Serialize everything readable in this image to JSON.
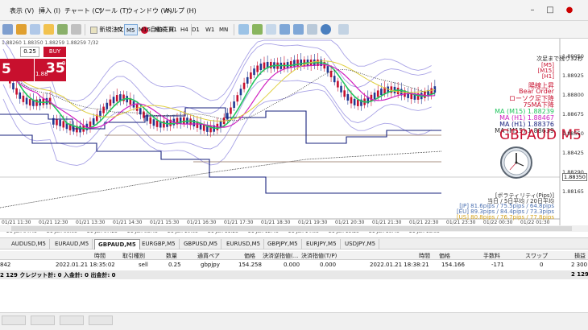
{
  "menu": {
    "items": [
      "表示 (V)",
      "挿入 (I)",
      "チャート (C)",
      "ツール (T)",
      "ウィンドウ (W)",
      "ヘルプ (H)"
    ]
  },
  "toolbar": {
    "new_order_label": "新規注文",
    "auto_trade_label": "自動売買",
    "timeframes": [
      "M1",
      "M5",
      "M15",
      "M30",
      "H1",
      "H4",
      "D1",
      "W1",
      "MN"
    ],
    "active_timeframe": "M5"
  },
  "trade_panel": {
    "lot": "0.25",
    "buy_label": "BUY",
    "bid_small": "",
    "bid_big": "5",
    "ask_small": "1.88",
    "ask_big": "35",
    "ask_sup": "9",
    "header_prices": "1.88260 1.88350 1.88259 1.88259 7/32"
  },
  "chart": {
    "symbol": "GBPAUD M5",
    "countdown": "次足まで残り32秒",
    "status_lines": [
      "[M5]",
      "[M15]",
      "[H1]"
    ],
    "signal_lines": [
      "陽線上昇",
      "Bear Order",
      "ローソク足下降",
      "75MA下降"
    ],
    "ma_lines": [
      "MA (M15) 1.88239",
      "MA (H1) 1.88467",
      "MA (H1) 1.88376",
      "MA (M15) 1.88639"
    ],
    "current_price": "1.88350",
    "price_levels": [
      "1.89050",
      "1.88925",
      "1.88800",
      "1.88675",
      "1.88550",
      "1.88425",
      "1.88290",
      "1.88165"
    ],
    "volatility_title": "[ボラティリティ(Pips)]",
    "volatility_sub": "当日 / 5日平均 / 20日平均",
    "volatility_rows": [
      "[JP] 81.6pips / 75.5pips / 64.8pips",
      "[EU] 89.3pips / 84.4pips / 73.3pips",
      "[US] 80.8pips / 76.7pips / 77.8pips"
    ],
    "time_labels_top": [
      "2022/01/21 11:30",
      "2022/01/21 12:30",
      "2022/01/21 13:30",
      "2022/01/21 14:30",
      "2022/01/21 15:30",
      "2022/01/21 16:30",
      "2022/01/21 17:30",
      "2022/01/21 18:30",
      "2022/01/21 19:30",
      "2022/01/21 20:30",
      "2022/01/21 21:30",
      "2022/01/21 22:30",
      "2022/01/21 23:30",
      "2022/01/22 00:30",
      "2022/01/22 01:30"
    ],
    "time_labels_bottom": [
      "21 Jan 04:45",
      "21 Jan 06:05",
      "21 Jan 07:25",
      "21 Jan 08:45",
      "21 Jan 10:05",
      "21 Jan 11:25",
      "21 Jan 12:45",
      "21 Jan 14:05",
      "21 Jan 15:25",
      "21 Jan 16:45",
      "21 Jan 18:05"
    ]
  },
  "tabs": {
    "items": [
      "AUDUSD,M5",
      "EURAUD,M5",
      "GBPAUD,M5",
      "EURGBP,M5",
      "GBPUSD,M5",
      "EURUSD,M5",
      "GBPJPY,M5",
      "EURJPY,M5",
      "USDJPY,M5"
    ],
    "active": "GBPAUD,M5"
  },
  "terminal": {
    "headers": [
      "時間",
      "取引種別",
      "数量",
      "通貨ペア",
      "価格",
      "決済逆指値(...",
      "決済指値(T/P)",
      "時間",
      "価格",
      "手数料",
      "スワップ",
      "損益"
    ],
    "row": [
      "842",
      "2022.01.21 18:35:02",
      "sell",
      "0.25",
      "gbpjpy",
      "154.258",
      "0.000",
      "0.000",
      "2022.01.21 18:38:21",
      "154.166",
      "-171",
      "0",
      "2 300"
    ],
    "balance_text": "2 129  クレジット計: 0  入金計: 0  出金計: 0",
    "balance_total": "2 129"
  },
  "colors": {
    "accent_red": "#c8102e",
    "ma_green": "#22c55e",
    "ma_magenta": "#d020c0",
    "ma_blue": "#1a237e",
    "band_lavender": "#a9a3e6",
    "candle_up": "#1f3a93",
    "candle_down": "#c8102e"
  }
}
